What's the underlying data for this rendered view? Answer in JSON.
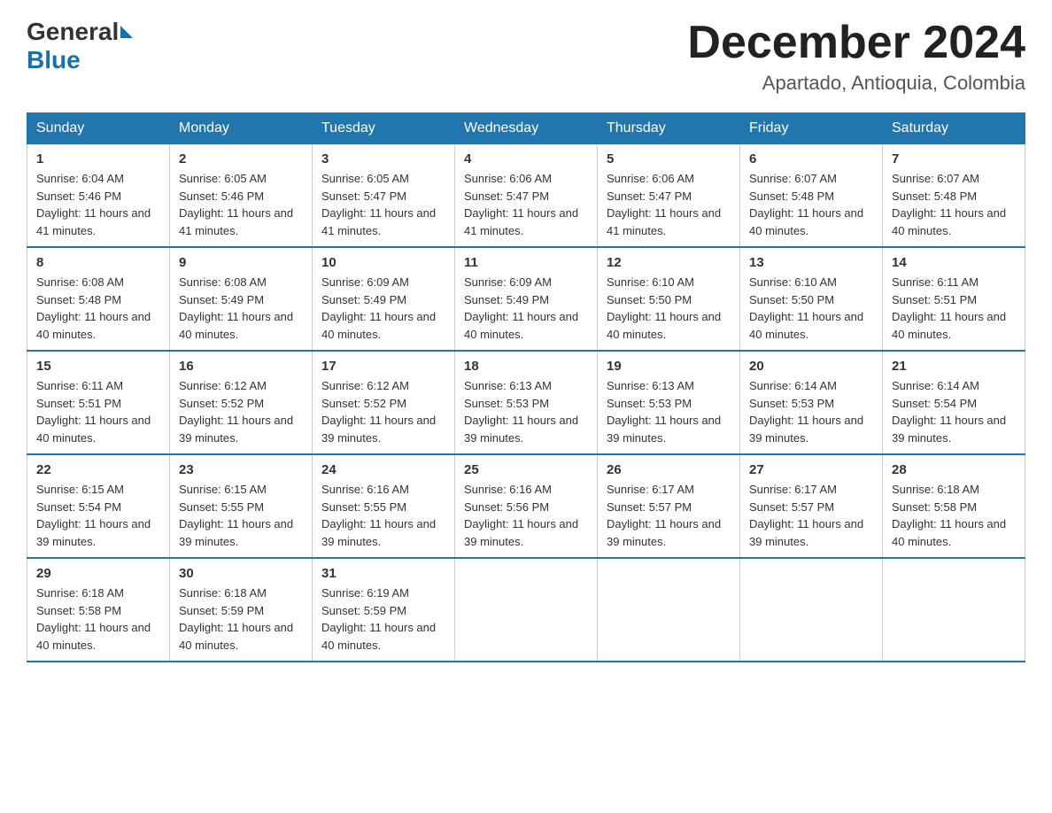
{
  "header": {
    "logo_general": "General",
    "logo_blue": "Blue",
    "month_title": "December 2024",
    "location": "Apartado, Antioquia, Colombia"
  },
  "weekdays": [
    "Sunday",
    "Monday",
    "Tuesday",
    "Wednesday",
    "Thursday",
    "Friday",
    "Saturday"
  ],
  "weeks": [
    [
      {
        "day": "1",
        "sunrise": "6:04 AM",
        "sunset": "5:46 PM",
        "daylight": "11 hours and 41 minutes."
      },
      {
        "day": "2",
        "sunrise": "6:05 AM",
        "sunset": "5:46 PM",
        "daylight": "11 hours and 41 minutes."
      },
      {
        "day": "3",
        "sunrise": "6:05 AM",
        "sunset": "5:47 PM",
        "daylight": "11 hours and 41 minutes."
      },
      {
        "day": "4",
        "sunrise": "6:06 AM",
        "sunset": "5:47 PM",
        "daylight": "11 hours and 41 minutes."
      },
      {
        "day": "5",
        "sunrise": "6:06 AM",
        "sunset": "5:47 PM",
        "daylight": "11 hours and 41 minutes."
      },
      {
        "day": "6",
        "sunrise": "6:07 AM",
        "sunset": "5:48 PM",
        "daylight": "11 hours and 40 minutes."
      },
      {
        "day": "7",
        "sunrise": "6:07 AM",
        "sunset": "5:48 PM",
        "daylight": "11 hours and 40 minutes."
      }
    ],
    [
      {
        "day": "8",
        "sunrise": "6:08 AM",
        "sunset": "5:48 PM",
        "daylight": "11 hours and 40 minutes."
      },
      {
        "day": "9",
        "sunrise": "6:08 AM",
        "sunset": "5:49 PM",
        "daylight": "11 hours and 40 minutes."
      },
      {
        "day": "10",
        "sunrise": "6:09 AM",
        "sunset": "5:49 PM",
        "daylight": "11 hours and 40 minutes."
      },
      {
        "day": "11",
        "sunrise": "6:09 AM",
        "sunset": "5:49 PM",
        "daylight": "11 hours and 40 minutes."
      },
      {
        "day": "12",
        "sunrise": "6:10 AM",
        "sunset": "5:50 PM",
        "daylight": "11 hours and 40 minutes."
      },
      {
        "day": "13",
        "sunrise": "6:10 AM",
        "sunset": "5:50 PM",
        "daylight": "11 hours and 40 minutes."
      },
      {
        "day": "14",
        "sunrise": "6:11 AM",
        "sunset": "5:51 PM",
        "daylight": "11 hours and 40 minutes."
      }
    ],
    [
      {
        "day": "15",
        "sunrise": "6:11 AM",
        "sunset": "5:51 PM",
        "daylight": "11 hours and 40 minutes."
      },
      {
        "day": "16",
        "sunrise": "6:12 AM",
        "sunset": "5:52 PM",
        "daylight": "11 hours and 39 minutes."
      },
      {
        "day": "17",
        "sunrise": "6:12 AM",
        "sunset": "5:52 PM",
        "daylight": "11 hours and 39 minutes."
      },
      {
        "day": "18",
        "sunrise": "6:13 AM",
        "sunset": "5:53 PM",
        "daylight": "11 hours and 39 minutes."
      },
      {
        "day": "19",
        "sunrise": "6:13 AM",
        "sunset": "5:53 PM",
        "daylight": "11 hours and 39 minutes."
      },
      {
        "day": "20",
        "sunrise": "6:14 AM",
        "sunset": "5:53 PM",
        "daylight": "11 hours and 39 minutes."
      },
      {
        "day": "21",
        "sunrise": "6:14 AM",
        "sunset": "5:54 PM",
        "daylight": "11 hours and 39 minutes."
      }
    ],
    [
      {
        "day": "22",
        "sunrise": "6:15 AM",
        "sunset": "5:54 PM",
        "daylight": "11 hours and 39 minutes."
      },
      {
        "day": "23",
        "sunrise": "6:15 AM",
        "sunset": "5:55 PM",
        "daylight": "11 hours and 39 minutes."
      },
      {
        "day": "24",
        "sunrise": "6:16 AM",
        "sunset": "5:55 PM",
        "daylight": "11 hours and 39 minutes."
      },
      {
        "day": "25",
        "sunrise": "6:16 AM",
        "sunset": "5:56 PM",
        "daylight": "11 hours and 39 minutes."
      },
      {
        "day": "26",
        "sunrise": "6:17 AM",
        "sunset": "5:57 PM",
        "daylight": "11 hours and 39 minutes."
      },
      {
        "day": "27",
        "sunrise": "6:17 AM",
        "sunset": "5:57 PM",
        "daylight": "11 hours and 39 minutes."
      },
      {
        "day": "28",
        "sunrise": "6:18 AM",
        "sunset": "5:58 PM",
        "daylight": "11 hours and 40 minutes."
      }
    ],
    [
      {
        "day": "29",
        "sunrise": "6:18 AM",
        "sunset": "5:58 PM",
        "daylight": "11 hours and 40 minutes."
      },
      {
        "day": "30",
        "sunrise": "6:18 AM",
        "sunset": "5:59 PM",
        "daylight": "11 hours and 40 minutes."
      },
      {
        "day": "31",
        "sunrise": "6:19 AM",
        "sunset": "5:59 PM",
        "daylight": "11 hours and 40 minutes."
      },
      null,
      null,
      null,
      null
    ]
  ]
}
